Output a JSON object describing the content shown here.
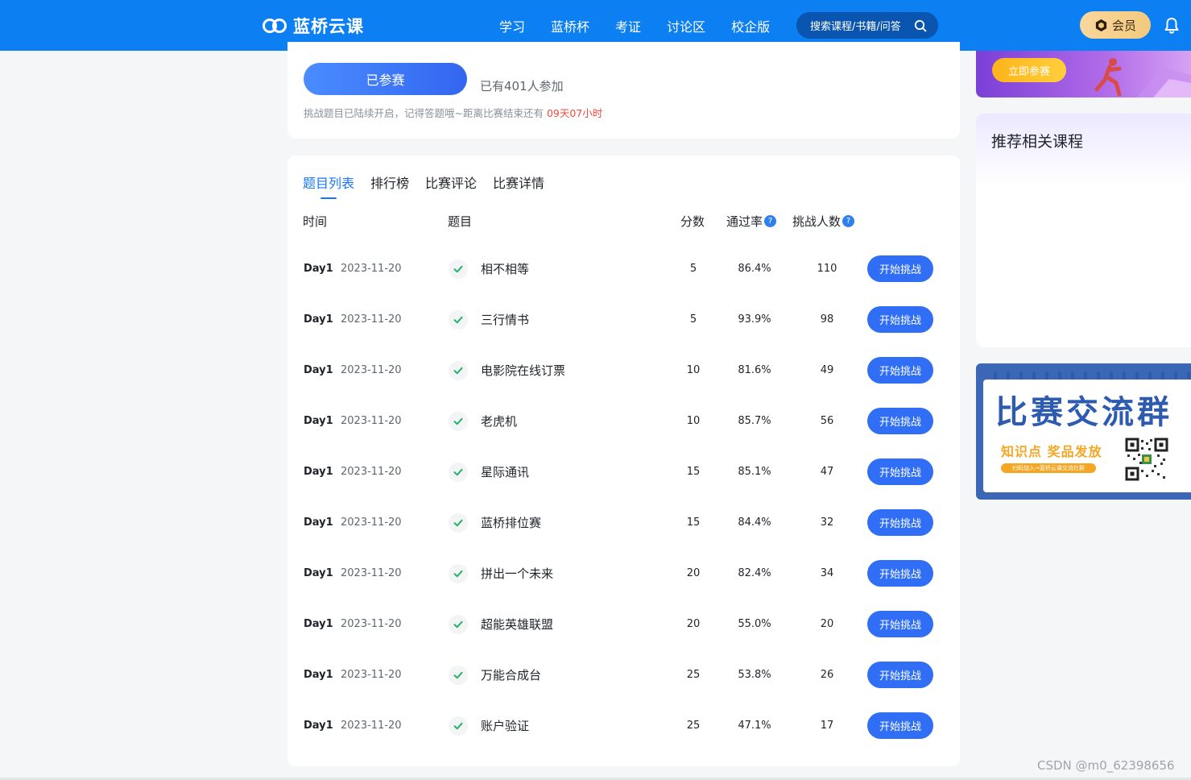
{
  "header": {
    "logo_text": "蓝桥云课",
    "nav": [
      "学习",
      "蓝桥杯",
      "考证",
      "讨论区",
      "校企版"
    ],
    "search_placeholder": "搜索课程/书籍/问答",
    "vip_label": "会员"
  },
  "contest": {
    "joined_label": "已参赛",
    "joined_count": "已有401人参加",
    "countdown_prefix": "挑战题目已陆续开启，记得答题哦~距离比赛结束还有 ",
    "countdown_time": "09天07小时"
  },
  "tabs": [
    {
      "label": "题目列表",
      "active": true
    },
    {
      "label": "排行榜",
      "active": false
    },
    {
      "label": "比赛评论",
      "active": false
    },
    {
      "label": "比赛详情",
      "active": false
    }
  ],
  "table": {
    "headers": {
      "time": "时间",
      "title": "题目",
      "score": "分数",
      "pass_rate": "通过率",
      "challengers": "挑战人数"
    },
    "action_label": "开始挑战",
    "rows": [
      {
        "day": "Day1",
        "date": "2023-11-20",
        "title": "相不相等",
        "score": "5",
        "rate": "86.4%",
        "count": "110"
      },
      {
        "day": "Day1",
        "date": "2023-11-20",
        "title": "三行情书",
        "score": "5",
        "rate": "93.9%",
        "count": "98"
      },
      {
        "day": "Day1",
        "date": "2023-11-20",
        "title": "电影院在线订票",
        "score": "10",
        "rate": "81.6%",
        "count": "49"
      },
      {
        "day": "Day1",
        "date": "2023-11-20",
        "title": "老虎机",
        "score": "10",
        "rate": "85.7%",
        "count": "56"
      },
      {
        "day": "Day1",
        "date": "2023-11-20",
        "title": "星际通讯",
        "score": "15",
        "rate": "85.1%",
        "count": "47"
      },
      {
        "day": "Day1",
        "date": "2023-11-20",
        "title": "蓝桥排位赛",
        "score": "15",
        "rate": "84.4%",
        "count": "32"
      },
      {
        "day": "Day1",
        "date": "2023-11-20",
        "title": "拼出一个未来",
        "score": "20",
        "rate": "82.4%",
        "count": "34"
      },
      {
        "day": "Day1",
        "date": "2023-11-20",
        "title": "超能英雄联盟",
        "score": "20",
        "rate": "55.0%",
        "count": "20"
      },
      {
        "day": "Day1",
        "date": "2023-11-20",
        "title": "万能合成台",
        "score": "25",
        "rate": "53.8%",
        "count": "26"
      },
      {
        "day": "Day1",
        "date": "2023-11-20",
        "title": "账户验证",
        "score": "25",
        "rate": "47.1%",
        "count": "17"
      }
    ]
  },
  "sidebar": {
    "promo_button": "立即参赛",
    "recommend_title": "推荐相关课程",
    "group_banner": {
      "title": "比赛交流群",
      "subtitle": "知识点 奖品发放",
      "note": "扫码加入→蓝桥云课交流社群"
    }
  },
  "watermark": "CSDN @m0_62398656",
  "colors": {
    "primary": "#0c7ff2",
    "accent_blue": "#2f6ef5",
    "check_green": "#27b16a",
    "countdown_red": "#f5483b"
  }
}
